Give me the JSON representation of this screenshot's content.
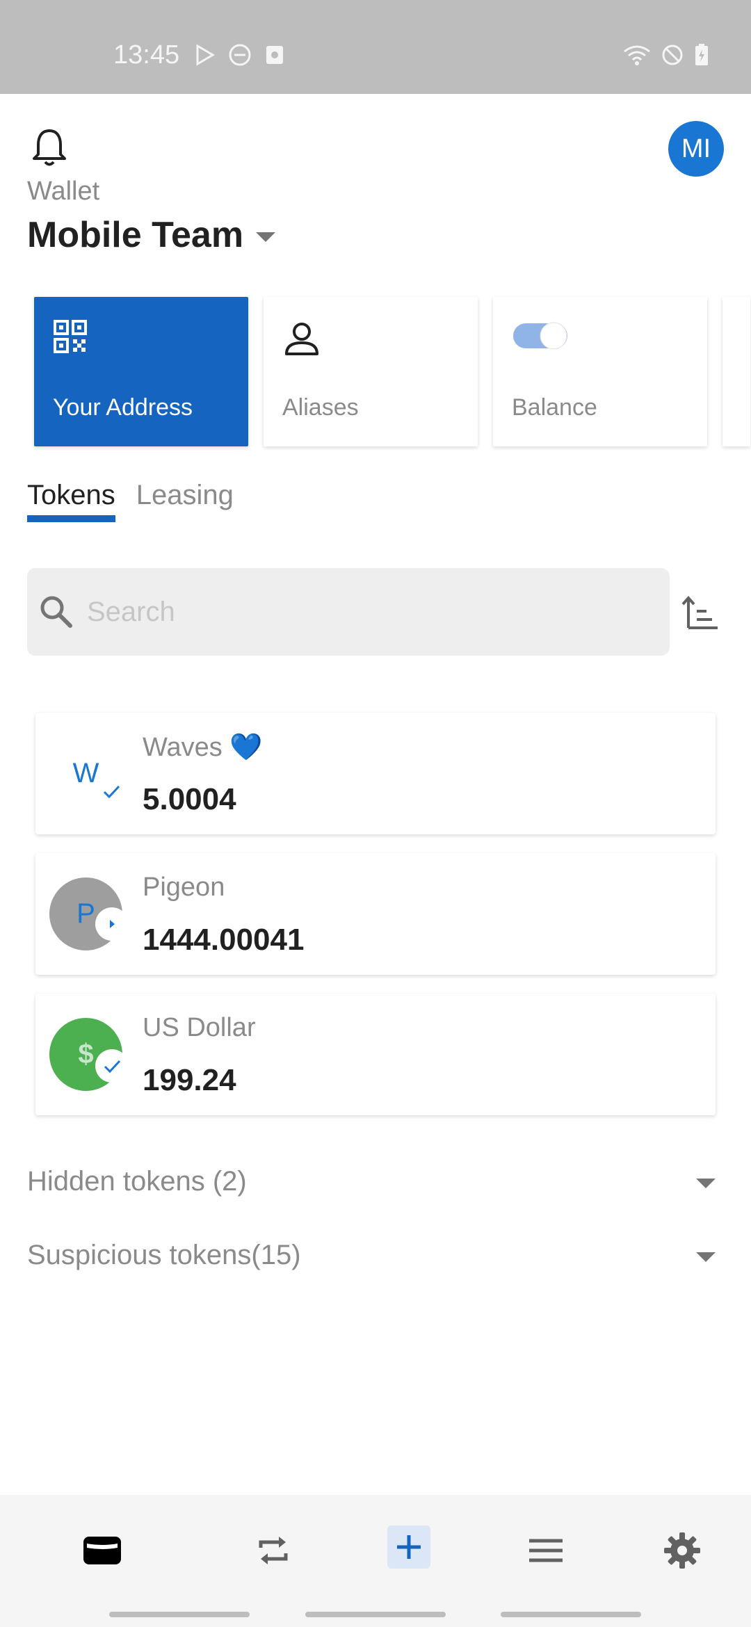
{
  "status_bar": {
    "time": "13:45"
  },
  "header": {
    "wallet_label": "Wallet",
    "wallet_name": "Mobile Team",
    "avatar_initials": "MI"
  },
  "actions": [
    {
      "label": "Your Address",
      "icon": "qr-code-icon",
      "active": true
    },
    {
      "label": "Aliases",
      "icon": "person-icon",
      "active": false
    },
    {
      "label": "Balance",
      "icon": "toggle-icon",
      "active": false
    }
  ],
  "tabs": [
    {
      "label": "Tokens",
      "active": true
    },
    {
      "label": "Leasing",
      "active": false
    }
  ],
  "search": {
    "placeholder": "Search"
  },
  "tokens": [
    {
      "name": "Waves 💙",
      "amount": "5.0004",
      "logo_text": "W",
      "logo_color": "#ffffff",
      "logo_text_color": "#1976d2"
    },
    {
      "name": "Pigeon",
      "amount": "1444.00041",
      "logo_text": "P",
      "logo_color": "#9e9e9e",
      "logo_text_color": "#1976d2"
    },
    {
      "name": "US Dollar",
      "amount": "199.24",
      "logo_text": "$",
      "logo_color": "#4caf50",
      "logo_text_color": "#c8e6c9"
    }
  ],
  "sections": {
    "hidden": "Hidden tokens (2)",
    "suspicious": "Suspicious tokens(15)"
  },
  "bottom_nav": [
    {
      "icon": "wallet-icon",
      "active": true
    },
    {
      "icon": "exchange-icon",
      "active": false
    },
    {
      "icon": "plus-icon",
      "active": false
    },
    {
      "icon": "menu-icon",
      "active": false
    },
    {
      "icon": "settings-icon",
      "active": false
    }
  ],
  "colors": {
    "accent": "#1565c0",
    "avatar": "#1976d2",
    "status_bar": "#bdbdbd"
  }
}
